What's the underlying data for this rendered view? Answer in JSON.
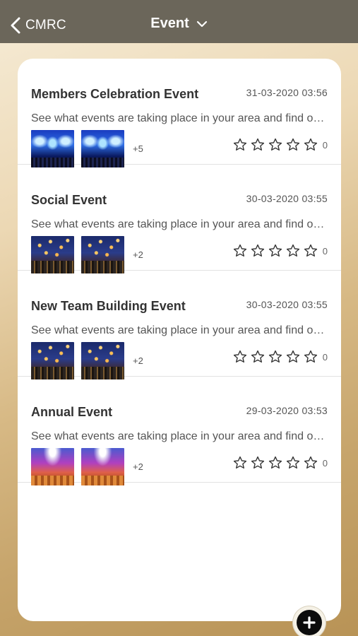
{
  "header": {
    "back_label": "CMRC",
    "title": "Event"
  },
  "events": [
    {
      "title": "Members Celebration Event",
      "date": "31-03-2020 03:56",
      "description": "See what events are taking place in your area and find out more",
      "thumb_style": "concert",
      "more_count": "+5",
      "rating": 0,
      "rating_count": "0"
    },
    {
      "title": "Social Event",
      "date": "30-03-2020 03:55",
      "description": "See what events are taking place in your area and find out more",
      "thumb_style": "lanterns",
      "more_count": "+2",
      "rating": 0,
      "rating_count": "0"
    },
    {
      "title": "New Team Building Event",
      "date": "30-03-2020 03:55",
      "description": "See what events are taking place in your area and find out more",
      "thumb_style": "lanterns",
      "more_count": "+2",
      "rating": 0,
      "rating_count": "0"
    },
    {
      "title": "Annual Event",
      "date": "29-03-2020 03:53",
      "description": "See what events are taking place in your area and find out more",
      "thumb_style": "stage",
      "more_count": "+2",
      "rating": 0,
      "rating_count": "0"
    }
  ],
  "icons": {
    "back": "chevron-left-icon",
    "title_dropdown": "chevron-down-icon",
    "star": "star-outline-icon",
    "add": "plus-icon"
  },
  "colors": {
    "header_bg": "#6b665a",
    "card_bg": "#ffffff",
    "text_primary": "#333333",
    "text_secondary": "#555555"
  }
}
